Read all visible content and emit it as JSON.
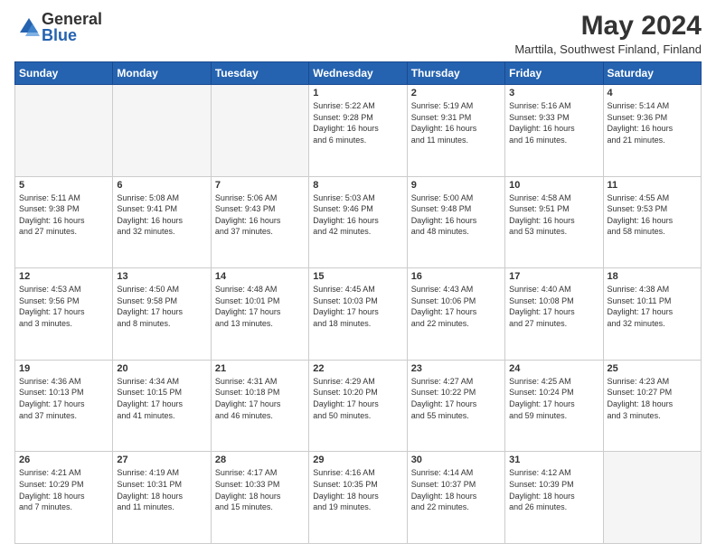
{
  "logo": {
    "general": "General",
    "blue": "Blue"
  },
  "title": "May 2024",
  "location": "Marttila, Southwest Finland, Finland",
  "weekdays": [
    "Sunday",
    "Monday",
    "Tuesday",
    "Wednesday",
    "Thursday",
    "Friday",
    "Saturday"
  ],
  "weeks": [
    [
      {
        "day": "",
        "info": ""
      },
      {
        "day": "",
        "info": ""
      },
      {
        "day": "",
        "info": ""
      },
      {
        "day": "1",
        "info": "Sunrise: 5:22 AM\nSunset: 9:28 PM\nDaylight: 16 hours\nand 6 minutes."
      },
      {
        "day": "2",
        "info": "Sunrise: 5:19 AM\nSunset: 9:31 PM\nDaylight: 16 hours\nand 11 minutes."
      },
      {
        "day": "3",
        "info": "Sunrise: 5:16 AM\nSunset: 9:33 PM\nDaylight: 16 hours\nand 16 minutes."
      },
      {
        "day": "4",
        "info": "Sunrise: 5:14 AM\nSunset: 9:36 PM\nDaylight: 16 hours\nand 21 minutes."
      }
    ],
    [
      {
        "day": "5",
        "info": "Sunrise: 5:11 AM\nSunset: 9:38 PM\nDaylight: 16 hours\nand 27 minutes."
      },
      {
        "day": "6",
        "info": "Sunrise: 5:08 AM\nSunset: 9:41 PM\nDaylight: 16 hours\nand 32 minutes."
      },
      {
        "day": "7",
        "info": "Sunrise: 5:06 AM\nSunset: 9:43 PM\nDaylight: 16 hours\nand 37 minutes."
      },
      {
        "day": "8",
        "info": "Sunrise: 5:03 AM\nSunset: 9:46 PM\nDaylight: 16 hours\nand 42 minutes."
      },
      {
        "day": "9",
        "info": "Sunrise: 5:00 AM\nSunset: 9:48 PM\nDaylight: 16 hours\nand 48 minutes."
      },
      {
        "day": "10",
        "info": "Sunrise: 4:58 AM\nSunset: 9:51 PM\nDaylight: 16 hours\nand 53 minutes."
      },
      {
        "day": "11",
        "info": "Sunrise: 4:55 AM\nSunset: 9:53 PM\nDaylight: 16 hours\nand 58 minutes."
      }
    ],
    [
      {
        "day": "12",
        "info": "Sunrise: 4:53 AM\nSunset: 9:56 PM\nDaylight: 17 hours\nand 3 minutes."
      },
      {
        "day": "13",
        "info": "Sunrise: 4:50 AM\nSunset: 9:58 PM\nDaylight: 17 hours\nand 8 minutes."
      },
      {
        "day": "14",
        "info": "Sunrise: 4:48 AM\nSunset: 10:01 PM\nDaylight: 17 hours\nand 13 minutes."
      },
      {
        "day": "15",
        "info": "Sunrise: 4:45 AM\nSunset: 10:03 PM\nDaylight: 17 hours\nand 18 minutes."
      },
      {
        "day": "16",
        "info": "Sunrise: 4:43 AM\nSunset: 10:06 PM\nDaylight: 17 hours\nand 22 minutes."
      },
      {
        "day": "17",
        "info": "Sunrise: 4:40 AM\nSunset: 10:08 PM\nDaylight: 17 hours\nand 27 minutes."
      },
      {
        "day": "18",
        "info": "Sunrise: 4:38 AM\nSunset: 10:11 PM\nDaylight: 17 hours\nand 32 minutes."
      }
    ],
    [
      {
        "day": "19",
        "info": "Sunrise: 4:36 AM\nSunset: 10:13 PM\nDaylight: 17 hours\nand 37 minutes."
      },
      {
        "day": "20",
        "info": "Sunrise: 4:34 AM\nSunset: 10:15 PM\nDaylight: 17 hours\nand 41 minutes."
      },
      {
        "day": "21",
        "info": "Sunrise: 4:31 AM\nSunset: 10:18 PM\nDaylight: 17 hours\nand 46 minutes."
      },
      {
        "day": "22",
        "info": "Sunrise: 4:29 AM\nSunset: 10:20 PM\nDaylight: 17 hours\nand 50 minutes."
      },
      {
        "day": "23",
        "info": "Sunrise: 4:27 AM\nSunset: 10:22 PM\nDaylight: 17 hours\nand 55 minutes."
      },
      {
        "day": "24",
        "info": "Sunrise: 4:25 AM\nSunset: 10:24 PM\nDaylight: 17 hours\nand 59 minutes."
      },
      {
        "day": "25",
        "info": "Sunrise: 4:23 AM\nSunset: 10:27 PM\nDaylight: 18 hours\nand 3 minutes."
      }
    ],
    [
      {
        "day": "26",
        "info": "Sunrise: 4:21 AM\nSunset: 10:29 PM\nDaylight: 18 hours\nand 7 minutes."
      },
      {
        "day": "27",
        "info": "Sunrise: 4:19 AM\nSunset: 10:31 PM\nDaylight: 18 hours\nand 11 minutes."
      },
      {
        "day": "28",
        "info": "Sunrise: 4:17 AM\nSunset: 10:33 PM\nDaylight: 18 hours\nand 15 minutes."
      },
      {
        "day": "29",
        "info": "Sunrise: 4:16 AM\nSunset: 10:35 PM\nDaylight: 18 hours\nand 19 minutes."
      },
      {
        "day": "30",
        "info": "Sunrise: 4:14 AM\nSunset: 10:37 PM\nDaylight: 18 hours\nand 22 minutes."
      },
      {
        "day": "31",
        "info": "Sunrise: 4:12 AM\nSunset: 10:39 PM\nDaylight: 18 hours\nand 26 minutes."
      },
      {
        "day": "",
        "info": ""
      }
    ]
  ]
}
